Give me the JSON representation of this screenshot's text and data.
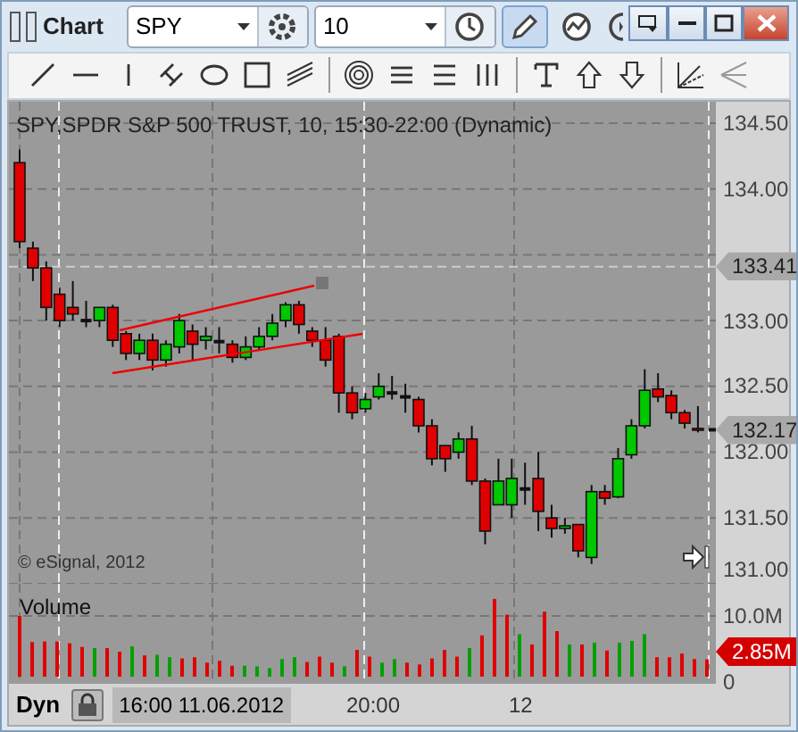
{
  "window": {
    "title": "Chart"
  },
  "header": {
    "symbol": "SPY",
    "interval": "10",
    "buttons": [
      {
        "kind": "gear",
        "selected": false
      },
      {
        "kind": "clock",
        "selected": false
      },
      {
        "kind": "pencil",
        "selected": true
      },
      {
        "kind": "study",
        "selected": false
      },
      {
        "kind": "play",
        "selected": false
      }
    ]
  },
  "drawing_tools": [
    {
      "kind": "line"
    },
    {
      "kind": "hline"
    },
    {
      "kind": "vline"
    },
    {
      "kind": "cross"
    },
    {
      "kind": "ellipse"
    },
    {
      "kind": "rect"
    },
    {
      "kind": "channel"
    },
    {
      "kind": "sep"
    },
    {
      "kind": "circles"
    },
    {
      "kind": "lines3"
    },
    {
      "kind": "lines3b"
    },
    {
      "kind": "vlines"
    },
    {
      "kind": "sep"
    },
    {
      "kind": "text"
    },
    {
      "kind": "uparrow"
    },
    {
      "kind": "downarrow"
    },
    {
      "kind": "sep"
    },
    {
      "kind": "fan"
    },
    {
      "kind": "fanleft"
    }
  ],
  "chart": {
    "title": "SPY,SPDR S&P 500 TRUST, 10, 15:30-22:00 (Dynamic)",
    "copyright": "© eSignal, 2012",
    "price_ticks": [
      "134.50",
      "134.00",
      "133.00",
      "132.50",
      "132.00",
      "131.50",
      "131.00"
    ],
    "price_tags": [
      {
        "text": "133.41",
        "kind": "gray"
      },
      {
        "text": "132.17",
        "kind": "gray"
      }
    ],
    "volume_label": "Volume",
    "volume_ticks": [
      "10.0M",
      "0"
    ],
    "volume_tag": {
      "text": "2.85M",
      "kind": "red"
    },
    "time_labels": [
      "20:00",
      "12"
    ],
    "start_time": "16:00 11.06.2012",
    "mode": "Dyn"
  }
}
